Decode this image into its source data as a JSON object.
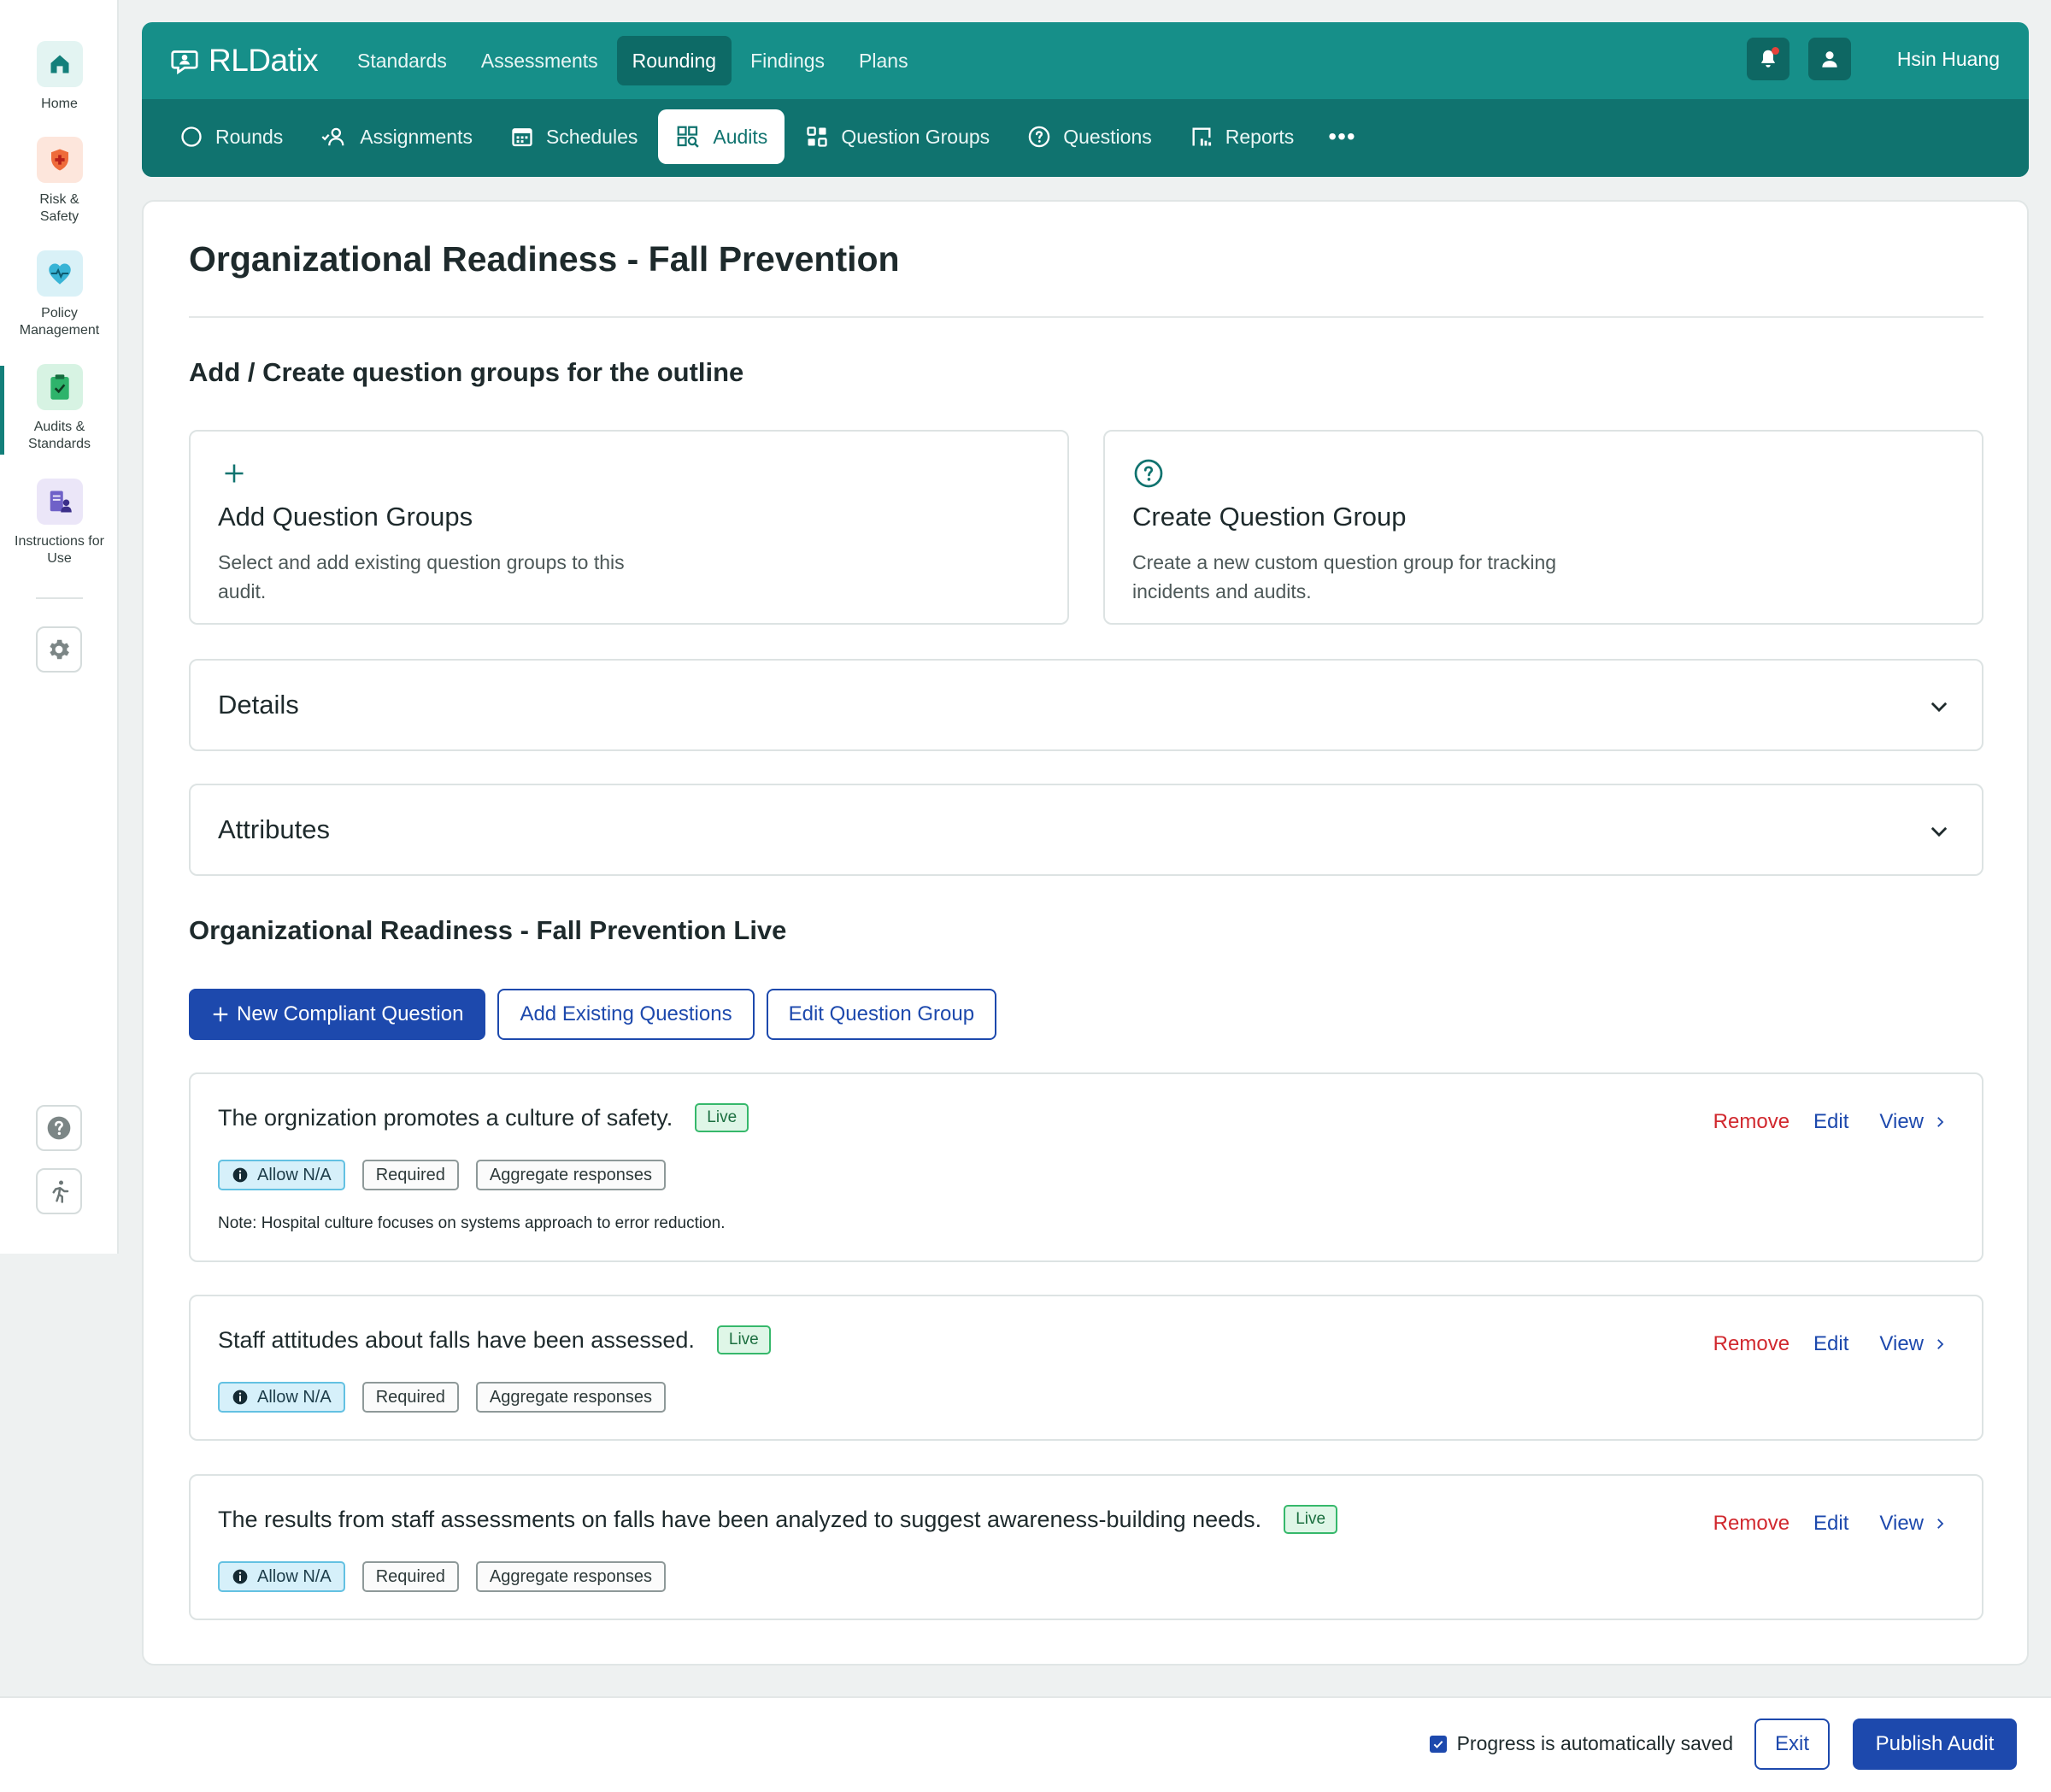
{
  "app": {
    "logo_text": "RLDatix"
  },
  "sidebar": {
    "items": [
      {
        "label": "Home",
        "icon": "home-icon"
      },
      {
        "label": "Risk & Safety",
        "icon": "shield-plus-icon"
      },
      {
        "label": "Policy Management",
        "icon": "heart-pulse-icon"
      },
      {
        "label": "Audits & Standards",
        "icon": "clipboard-check-icon"
      },
      {
        "label": "Instructions for Use",
        "icon": "document-user-icon"
      }
    ],
    "active_item": "Audits & Standards",
    "settings_icon": "gear-icon",
    "help_icon": "help-icon",
    "accessibility_icon": "running-person-icon"
  },
  "header": {
    "topnav": [
      "Standards",
      "Assessments",
      "Rounding",
      "Findings",
      "Plans"
    ],
    "topnav_active": "Rounding",
    "user_name": "Hsin Huang",
    "subnav": [
      {
        "label": "Rounds",
        "icon": "circle-icon"
      },
      {
        "label": "Assignments",
        "icon": "person-check-icon"
      },
      {
        "label": "Schedules",
        "icon": "calendar-icon"
      },
      {
        "label": "Audits",
        "icon": "audit-search-icon"
      },
      {
        "label": "Question Groups",
        "icon": "grid-icon"
      },
      {
        "label": "Questions",
        "icon": "question-circle-icon"
      },
      {
        "label": "Reports",
        "icon": "report-icon"
      }
    ],
    "subnav_active": "Audits",
    "more_label": "•••"
  },
  "main": {
    "title": "Organizational Readiness - Fall Prevention",
    "outline_heading": "Add / Create question groups for the outline",
    "add_card": {
      "title": "Add Question Groups",
      "description": "Select and add existing question groups to this audit."
    },
    "create_card": {
      "title": "Create Question Group",
      "description": "Create a new custom question group for tracking incidents and audits."
    },
    "accordions": [
      "Details",
      "Attributes"
    ],
    "group_heading": "Organizational Readiness - Fall Prevention Live",
    "buttons": {
      "new_question": "New Compliant Question",
      "add_existing": "Add Existing Questions",
      "edit_group": "Edit Question Group"
    },
    "questions": [
      {
        "text": "The orgnization promotes a culture of safety.",
        "status": "Live",
        "tags": [
          "Allow N/A",
          "Required",
          "Aggregate responses"
        ],
        "note": "Note: Hospital culture focuses on systems approach to error reduction."
      },
      {
        "text": "Staff attitudes about falls have been assessed.",
        "status": "Live",
        "tags": [
          "Allow N/A",
          "Required",
          "Aggregate responses"
        ]
      },
      {
        "text": "The results from staff assessments on falls have been analyzed to suggest awareness-building needs.",
        "status": "Live",
        "tags": [
          "Allow N/A",
          "Required",
          "Aggregate responses"
        ]
      }
    ],
    "actions": {
      "remove": "Remove",
      "edit": "Edit",
      "view": "View"
    }
  },
  "footer": {
    "autosave_text": "Progress is automatically saved",
    "autosave_checked": true,
    "exit_label": "Exit",
    "publish_label": "Publish Audit"
  },
  "colors": {
    "brand_teal": "#168f89",
    "brand_teal_dark": "#10736f",
    "primary_blue": "#1d49ad",
    "danger_red": "#d1282e",
    "live_green": "#36b86b"
  }
}
